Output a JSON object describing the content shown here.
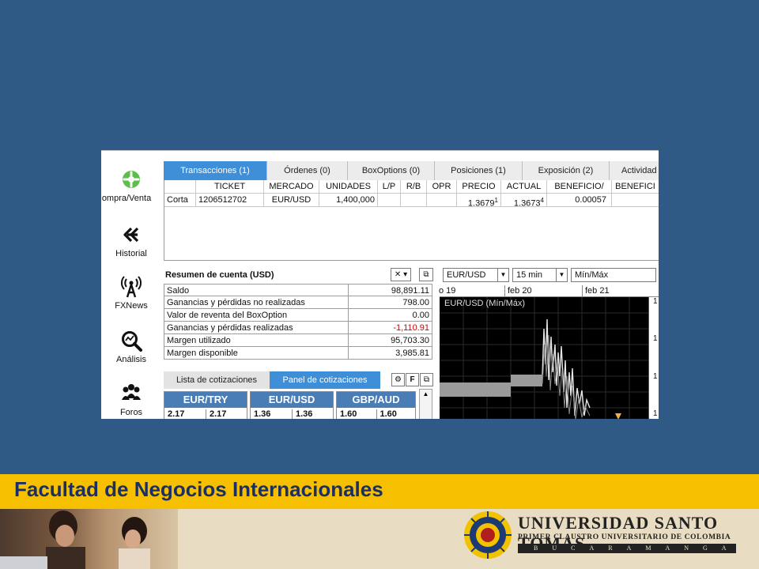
{
  "sidebar": {
    "items": [
      {
        "label": "ompra/Venta",
        "icon": "gear-flower-icon"
      },
      {
        "label": "Historial",
        "icon": "double-chevron-left-icon"
      },
      {
        "label": "FXNews",
        "icon": "antenna-icon"
      },
      {
        "label": "Análisis",
        "icon": "magnifier-chart-icon"
      },
      {
        "label": "Foros",
        "icon": "people-icon"
      }
    ]
  },
  "tabs": [
    {
      "label": "Transacciones (1)"
    },
    {
      "label": "Órdenes (0)"
    },
    {
      "label": "BoxOptions (0)"
    },
    {
      "label": "Posiciones (1)"
    },
    {
      "label": "Exposición (2)"
    },
    {
      "label": "Actividad"
    }
  ],
  "grid": {
    "headers": [
      "TICKET",
      "MERCADO",
      "UNIDADES",
      "L/P",
      "R/B",
      "OPR",
      "PRECIO",
      "ACTUAL",
      "BENEFICIO/",
      "BENEFICI"
    ],
    "row": {
      "type": "Corta",
      "ticket": "1206512702",
      "market": "EUR/USD",
      "units": "1,400,000",
      "price": "1.3679",
      "price_sup": "1",
      "current": "1.3673",
      "current_sup": "4",
      "profit": "0.00057"
    }
  },
  "account": {
    "title": "Resumen de cuenta (USD)",
    "close_btn": "✕",
    "rows": [
      {
        "label": "Saldo",
        "value": "98,891.11"
      },
      {
        "label": "Ganancias y pérdidas no realizadas",
        "value": "798.00"
      },
      {
        "label": "Valor de reventa del BoxOption",
        "value": "0.00"
      },
      {
        "label": "Ganancias y pérdidas realizadas",
        "value": "-1,110.91"
      },
      {
        "label": "Margen utilizado",
        "value": "95,703.30"
      },
      {
        "label": "Margen disponible",
        "value": "3,985.81"
      }
    ],
    "negative_color": "#cc0000"
  },
  "quotes": {
    "tabs": [
      {
        "label": "Lista de cotizaciones"
      },
      {
        "label": "Panel de cotizaciones"
      }
    ],
    "font_btn": "F",
    "boxes": [
      {
        "pair": "EUR/TRY",
        "bid": "2.17",
        "ask": "2.17"
      },
      {
        "pair": "EUR/USD",
        "bid": "1.36",
        "ask": "1.36"
      },
      {
        "pair": "GBP/AUD",
        "bid": "1.60",
        "ask": "1.60"
      }
    ]
  },
  "chart_toolbar": {
    "instrument": "EUR/USD",
    "interval": "15 min",
    "mode": "Mín/Máx"
  },
  "chart": {
    "title": "EUR/USD (Mín/Máx)",
    "dates": [
      "o 19",
      "feb 20",
      "feb 21"
    ],
    "y_ticks": [
      "1",
      "1",
      "1",
      "1"
    ]
  },
  "banner": {
    "title": "Facultad de Negocios Internacionales"
  },
  "university": {
    "name": "UNIVERSIDAD SANTO TOMAS",
    "subtitle": "PRIMER CLAUSTRO UNIVERSITARIO DE COLOMBIA",
    "city": "BUCARAMANGA"
  },
  "colors": {
    "background": "#2f5a85",
    "tab_active": "#3f8ed8",
    "quote_header": "#4a7db6",
    "banner": "#f6c000",
    "banner_text": "#1b2f63"
  }
}
